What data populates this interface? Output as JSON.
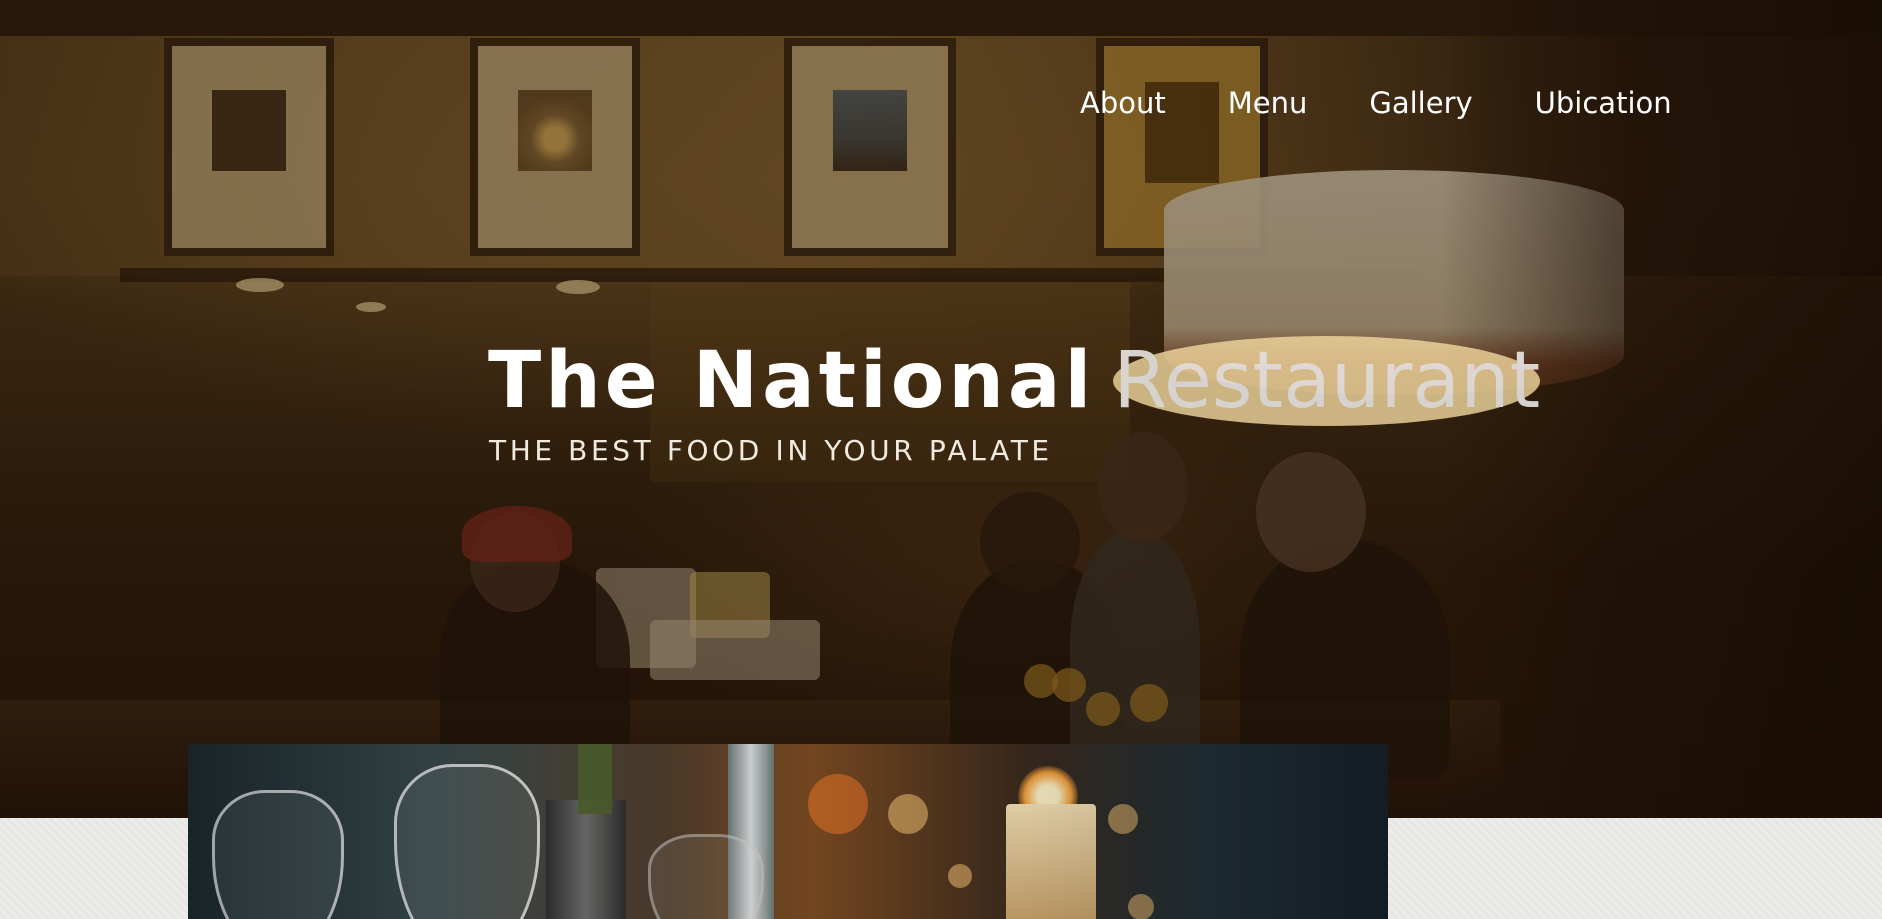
{
  "nav": {
    "items": [
      {
        "label": "About"
      },
      {
        "label": "Menu"
      },
      {
        "label": "Gallery"
      },
      {
        "label": "Ubication"
      }
    ]
  },
  "hero": {
    "title_bold": "The National",
    "title_light": "Restaurant",
    "tagline": "THE BEST FOOD IN YOUR PALATE"
  },
  "colors": {
    "text": "#ffffff",
    "hero_overlay": "#231206",
    "section_background": "#ebebea"
  }
}
